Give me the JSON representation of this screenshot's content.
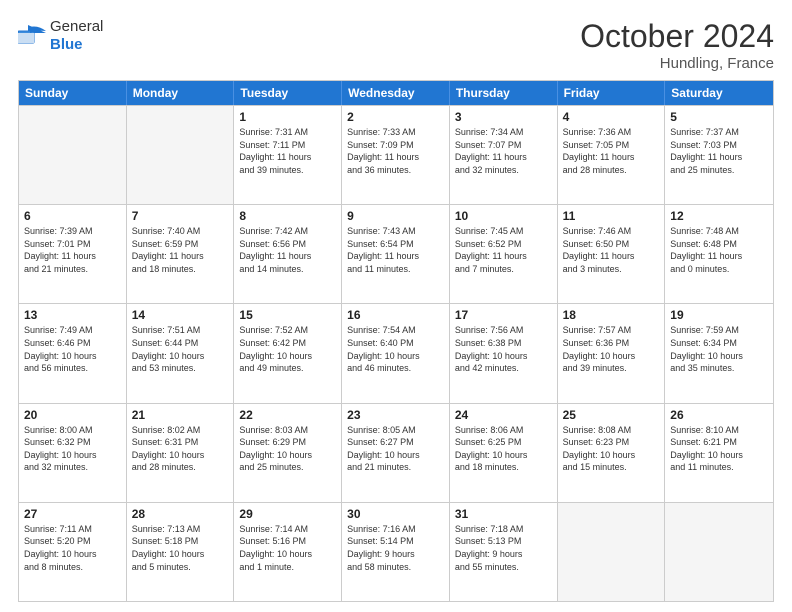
{
  "header": {
    "logo_general": "General",
    "logo_blue": "Blue",
    "month_title": "October 2024",
    "location": "Hundling, France"
  },
  "weekdays": [
    "Sunday",
    "Monday",
    "Tuesday",
    "Wednesday",
    "Thursday",
    "Friday",
    "Saturday"
  ],
  "weeks": [
    [
      {
        "day": "",
        "info": "",
        "empty": true
      },
      {
        "day": "",
        "info": "",
        "empty": true
      },
      {
        "day": "1",
        "info": "Sunrise: 7:31 AM\nSunset: 7:11 PM\nDaylight: 11 hours\nand 39 minutes."
      },
      {
        "day": "2",
        "info": "Sunrise: 7:33 AM\nSunset: 7:09 PM\nDaylight: 11 hours\nand 36 minutes."
      },
      {
        "day": "3",
        "info": "Sunrise: 7:34 AM\nSunset: 7:07 PM\nDaylight: 11 hours\nand 32 minutes."
      },
      {
        "day": "4",
        "info": "Sunrise: 7:36 AM\nSunset: 7:05 PM\nDaylight: 11 hours\nand 28 minutes."
      },
      {
        "day": "5",
        "info": "Sunrise: 7:37 AM\nSunset: 7:03 PM\nDaylight: 11 hours\nand 25 minutes."
      }
    ],
    [
      {
        "day": "6",
        "info": "Sunrise: 7:39 AM\nSunset: 7:01 PM\nDaylight: 11 hours\nand 21 minutes."
      },
      {
        "day": "7",
        "info": "Sunrise: 7:40 AM\nSunset: 6:59 PM\nDaylight: 11 hours\nand 18 minutes."
      },
      {
        "day": "8",
        "info": "Sunrise: 7:42 AM\nSunset: 6:56 PM\nDaylight: 11 hours\nand 14 minutes."
      },
      {
        "day": "9",
        "info": "Sunrise: 7:43 AM\nSunset: 6:54 PM\nDaylight: 11 hours\nand 11 minutes."
      },
      {
        "day": "10",
        "info": "Sunrise: 7:45 AM\nSunset: 6:52 PM\nDaylight: 11 hours\nand 7 minutes."
      },
      {
        "day": "11",
        "info": "Sunrise: 7:46 AM\nSunset: 6:50 PM\nDaylight: 11 hours\nand 3 minutes."
      },
      {
        "day": "12",
        "info": "Sunrise: 7:48 AM\nSunset: 6:48 PM\nDaylight: 11 hours\nand 0 minutes."
      }
    ],
    [
      {
        "day": "13",
        "info": "Sunrise: 7:49 AM\nSunset: 6:46 PM\nDaylight: 10 hours\nand 56 minutes."
      },
      {
        "day": "14",
        "info": "Sunrise: 7:51 AM\nSunset: 6:44 PM\nDaylight: 10 hours\nand 53 minutes."
      },
      {
        "day": "15",
        "info": "Sunrise: 7:52 AM\nSunset: 6:42 PM\nDaylight: 10 hours\nand 49 minutes."
      },
      {
        "day": "16",
        "info": "Sunrise: 7:54 AM\nSunset: 6:40 PM\nDaylight: 10 hours\nand 46 minutes."
      },
      {
        "day": "17",
        "info": "Sunrise: 7:56 AM\nSunset: 6:38 PM\nDaylight: 10 hours\nand 42 minutes."
      },
      {
        "day": "18",
        "info": "Sunrise: 7:57 AM\nSunset: 6:36 PM\nDaylight: 10 hours\nand 39 minutes."
      },
      {
        "day": "19",
        "info": "Sunrise: 7:59 AM\nSunset: 6:34 PM\nDaylight: 10 hours\nand 35 minutes."
      }
    ],
    [
      {
        "day": "20",
        "info": "Sunrise: 8:00 AM\nSunset: 6:32 PM\nDaylight: 10 hours\nand 32 minutes."
      },
      {
        "day": "21",
        "info": "Sunrise: 8:02 AM\nSunset: 6:31 PM\nDaylight: 10 hours\nand 28 minutes."
      },
      {
        "day": "22",
        "info": "Sunrise: 8:03 AM\nSunset: 6:29 PM\nDaylight: 10 hours\nand 25 minutes."
      },
      {
        "day": "23",
        "info": "Sunrise: 8:05 AM\nSunset: 6:27 PM\nDaylight: 10 hours\nand 21 minutes."
      },
      {
        "day": "24",
        "info": "Sunrise: 8:06 AM\nSunset: 6:25 PM\nDaylight: 10 hours\nand 18 minutes."
      },
      {
        "day": "25",
        "info": "Sunrise: 8:08 AM\nSunset: 6:23 PM\nDaylight: 10 hours\nand 15 minutes."
      },
      {
        "day": "26",
        "info": "Sunrise: 8:10 AM\nSunset: 6:21 PM\nDaylight: 10 hours\nand 11 minutes."
      }
    ],
    [
      {
        "day": "27",
        "info": "Sunrise: 7:11 AM\nSunset: 5:20 PM\nDaylight: 10 hours\nand 8 minutes."
      },
      {
        "day": "28",
        "info": "Sunrise: 7:13 AM\nSunset: 5:18 PM\nDaylight: 10 hours\nand 5 minutes."
      },
      {
        "day": "29",
        "info": "Sunrise: 7:14 AM\nSunset: 5:16 PM\nDaylight: 10 hours\nand 1 minute."
      },
      {
        "day": "30",
        "info": "Sunrise: 7:16 AM\nSunset: 5:14 PM\nDaylight: 9 hours\nand 58 minutes."
      },
      {
        "day": "31",
        "info": "Sunrise: 7:18 AM\nSunset: 5:13 PM\nDaylight: 9 hours\nand 55 minutes."
      },
      {
        "day": "",
        "info": "",
        "empty": true
      },
      {
        "day": "",
        "info": "",
        "empty": true
      }
    ]
  ]
}
